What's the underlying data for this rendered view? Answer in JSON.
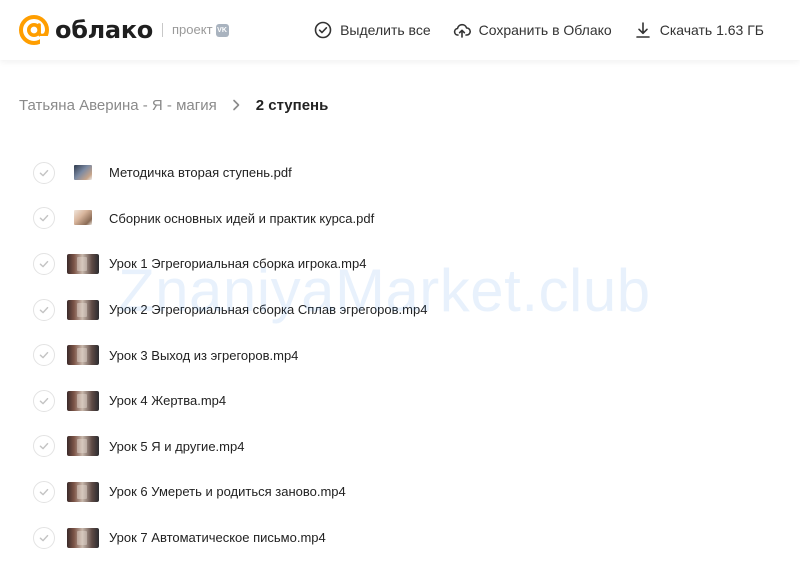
{
  "header": {
    "logo_text": "облако",
    "logo_sub": "проект",
    "logo_badge": "VK",
    "actions": [
      {
        "label": "Выделить все",
        "icon": "check-circle-icon"
      },
      {
        "label": "Сохранить в Облако",
        "icon": "cloud-upload-icon"
      },
      {
        "label": "Скачать 1.63 ГБ",
        "icon": "download-icon"
      }
    ]
  },
  "breadcrumb": {
    "parent": "Татьяна Аверина - Я - магия",
    "current": "2 ступень"
  },
  "files": [
    {
      "name": "Методичка вторая ступень.pdf",
      "type": "pdf"
    },
    {
      "name": "Сборник основных идей и практик курса.pdf",
      "type": "pdf"
    },
    {
      "name": "Урок 1 Эгрегориальная сборка игрока.mp4",
      "type": "video"
    },
    {
      "name": "Урок 2 Эгрегориальная сборка Сплав эгрегоров.mp4",
      "type": "video"
    },
    {
      "name": "Урок 3 Выход из эгрегоров.mp4",
      "type": "video"
    },
    {
      "name": "Урок 4 Жертва.mp4",
      "type": "video"
    },
    {
      "name": "Урок 5 Я и другие.mp4",
      "type": "video"
    },
    {
      "name": "Урок 6 Умереть и родиться заново.mp4",
      "type": "video"
    },
    {
      "name": "Урок 7 Автоматическое письмо.mp4",
      "type": "video"
    }
  ],
  "watermark": "ZnaniyaMarket.club",
  "colors": {
    "brand_orange": "#ff9e00",
    "text": "#222222",
    "muted": "#8a8a8a"
  }
}
